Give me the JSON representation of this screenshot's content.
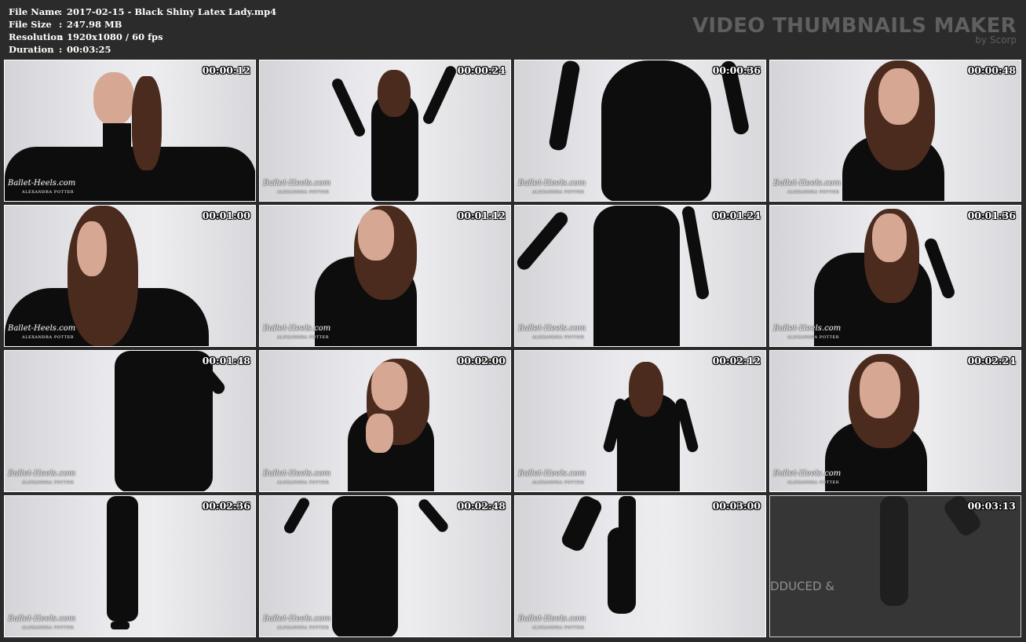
{
  "meta": {
    "file_name_label": "File Name",
    "file_name": "2017-02-15 - Black Shiny Latex Lady.mp4",
    "file_size_label": "File Size",
    "file_size": "247.98 MB",
    "resolution_label": "Resolution",
    "resolution": "1920x1080 / 60 fps",
    "duration_label": "Duration",
    "duration": "00:03:25"
  },
  "brand": {
    "title": "VIDEO THUMBNAILS MAKER",
    "subtitle": "by Scorp"
  },
  "watermark": {
    "line1": "Ballet-Heels.com",
    "line2": "ALEXANDRA POTTER"
  },
  "thumbnails": [
    {
      "timestamp": "00:00:12",
      "scene": "upper-body-front-arms-out"
    },
    {
      "timestamp": "00:00:24",
      "scene": "back-arms-up"
    },
    {
      "timestamp": "00:00:36",
      "scene": "close-back-hips"
    },
    {
      "timestamp": "00:00:48",
      "scene": "portrait-front"
    },
    {
      "timestamp": "00:01:00",
      "scene": "upper-body-hair-over-face"
    },
    {
      "timestamp": "00:01:12",
      "scene": "full-front-hands-at-side"
    },
    {
      "timestamp": "00:01:24",
      "scene": "close-back-legs"
    },
    {
      "timestamp": "00:01:36",
      "scene": "hand-on-head"
    },
    {
      "timestamp": "00:01:48",
      "scene": "close-legs-front"
    },
    {
      "timestamp": "00:02:00",
      "scene": "front-hands-raised"
    },
    {
      "timestamp": "00:02:12",
      "scene": "back-hands-on-hips"
    },
    {
      "timestamp": "00:02:24",
      "scene": "portrait-hand-near-chin"
    },
    {
      "timestamp": "00:02:36",
      "scene": "legs-ballet-heels"
    },
    {
      "timestamp": "00:02:48",
      "scene": "legs-arms-out"
    },
    {
      "timestamp": "00:03:00",
      "scene": "boots-close"
    },
    {
      "timestamp": "00:03:13",
      "scene": "dark-credits",
      "overlay": "DDUCED &"
    }
  ]
}
